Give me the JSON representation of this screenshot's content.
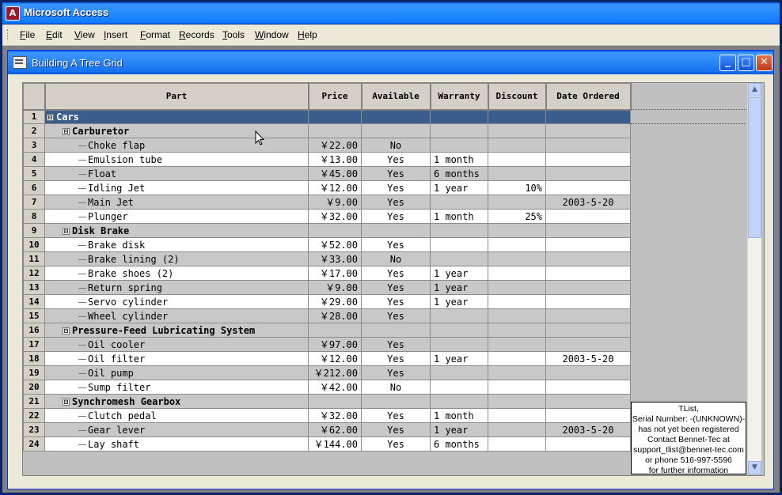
{
  "app": {
    "title": "Microsoft Access",
    "icon": "access-icon"
  },
  "menu": [
    {
      "key": "F",
      "rest": "ile"
    },
    {
      "key": "E",
      "rest": "dit"
    },
    {
      "key": "V",
      "rest": "iew"
    },
    {
      "key": "I",
      "rest": "nsert"
    },
    {
      "key": "F",
      "rest": "ormat"
    },
    {
      "key": "R",
      "rest": "ecords"
    },
    {
      "key": "T",
      "rest": "ools"
    },
    {
      "key": "W",
      "rest": "indow"
    },
    {
      "key": "H",
      "rest": "elp"
    }
  ],
  "window": {
    "title": "Building A Tree Grid",
    "minimize": "_",
    "maximize": "□",
    "close": "✕"
  },
  "columns": [
    "Part",
    "Price",
    "Available",
    "Warranty",
    "Discount",
    "Date Ordered"
  ],
  "rows": [
    {
      "n": "1",
      "level": 0,
      "toggle": "⊟",
      "part": "Cars",
      "price": "",
      "avail": "",
      "warranty": "",
      "discount": "",
      "date": ""
    },
    {
      "n": "2",
      "level": 1,
      "toggle": "⊟",
      "part": "Carburetor",
      "price": "",
      "avail": "",
      "warranty": "",
      "discount": "",
      "date": ""
    },
    {
      "n": "3",
      "level": 2,
      "part": "Choke flap",
      "price": "￥22.00",
      "avail": "No",
      "warranty": "",
      "discount": "",
      "date": ""
    },
    {
      "n": "4",
      "level": 2,
      "part": "Emulsion tube",
      "price": "￥13.00",
      "avail": "Yes",
      "warranty": "1 month",
      "discount": "",
      "date": ""
    },
    {
      "n": "5",
      "level": 2,
      "part": "Float",
      "price": "￥45.00",
      "avail": "Yes",
      "warranty": "6 months",
      "discount": "",
      "date": ""
    },
    {
      "n": "6",
      "level": 2,
      "part": "Idling Jet",
      "price": "￥12.00",
      "avail": "Yes",
      "warranty": "1 year",
      "discount": "10%",
      "date": ""
    },
    {
      "n": "7",
      "level": 2,
      "part": "Main Jet",
      "price": "￥9.00",
      "avail": "Yes",
      "warranty": "",
      "discount": "",
      "date": "2003-5-20"
    },
    {
      "n": "8",
      "level": 2,
      "part": "Plunger",
      "price": "￥32.00",
      "avail": "Yes",
      "warranty": "1 month",
      "discount": "25%",
      "date": ""
    },
    {
      "n": "9",
      "level": 1,
      "toggle": "⊟",
      "part": "Disk Brake",
      "price": "",
      "avail": "",
      "warranty": "",
      "discount": "",
      "date": ""
    },
    {
      "n": "10",
      "level": 2,
      "part": "Brake disk",
      "price": "￥52.00",
      "avail": "Yes",
      "warranty": "",
      "discount": "",
      "date": ""
    },
    {
      "n": "11",
      "level": 2,
      "part": "Brake lining (2)",
      "price": "￥33.00",
      "avail": "No",
      "warranty": "",
      "discount": "",
      "date": ""
    },
    {
      "n": "12",
      "level": 2,
      "part": "Brake shoes (2)",
      "price": "￥17.00",
      "avail": "Yes",
      "warranty": "1 year",
      "discount": "",
      "date": ""
    },
    {
      "n": "13",
      "level": 2,
      "part": "Return spring",
      "price": "￥9.00",
      "avail": "Yes",
      "warranty": "1 year",
      "discount": "",
      "date": ""
    },
    {
      "n": "14",
      "level": 2,
      "part": "Servo cylinder",
      "price": "￥29.00",
      "avail": "Yes",
      "warranty": "1 year",
      "discount": "",
      "date": ""
    },
    {
      "n": "15",
      "level": 2,
      "part": "Wheel cylinder",
      "price": "￥28.00",
      "avail": "Yes",
      "warranty": "",
      "discount": "",
      "date": ""
    },
    {
      "n": "16",
      "level": 1,
      "toggle": "⊟",
      "part": "Pressure-Feed Lubricating System",
      "price": "",
      "avail": "",
      "warranty": "",
      "discount": "",
      "date": ""
    },
    {
      "n": "17",
      "level": 2,
      "part": "Oil cooler",
      "price": "￥97.00",
      "avail": "Yes",
      "warranty": "",
      "discount": "",
      "date": ""
    },
    {
      "n": "18",
      "level": 2,
      "part": "Oil filter",
      "price": "￥12.00",
      "avail": "Yes",
      "warranty": "1 year",
      "discount": "",
      "date": "2003-5-20"
    },
    {
      "n": "19",
      "level": 2,
      "part": "Oil pump",
      "price": "￥212.00",
      "avail": "Yes",
      "warranty": "",
      "discount": "",
      "date": ""
    },
    {
      "n": "20",
      "level": 2,
      "part": "Sump filter",
      "price": "￥42.00",
      "avail": "No",
      "warranty": "",
      "discount": "",
      "date": ""
    },
    {
      "n": "21",
      "level": 1,
      "toggle": "⊟",
      "part": "Synchromesh Gearbox",
      "price": "",
      "avail": "",
      "warranty": "",
      "discount": "",
      "date": ""
    },
    {
      "n": "22",
      "level": 2,
      "part": "Clutch pedal",
      "price": "￥32.00",
      "avail": "Yes",
      "warranty": "1 month",
      "discount": "",
      "date": ""
    },
    {
      "n": "23",
      "level": 2,
      "part": "Gear lever",
      "price": "￥62.00",
      "avail": "Yes",
      "warranty": "1 year",
      "discount": "",
      "date": "2003-5-20"
    },
    {
      "n": "24",
      "level": 2,
      "part": "Lay shaft",
      "price": "￥144.00",
      "avail": "Yes",
      "warranty": "6 months",
      "discount": "",
      "date": ""
    }
  ],
  "notice": [
    "TList,",
    "Serial Number: -(UNKNOWN)-",
    "has not yet been registered",
    "Contact Bennet-Tec at",
    "support_tlist@bennet-tec.com",
    "or phone 516-997-5596",
    "for further information"
  ],
  "scroll": {
    "up": "▲",
    "down": "▼"
  }
}
